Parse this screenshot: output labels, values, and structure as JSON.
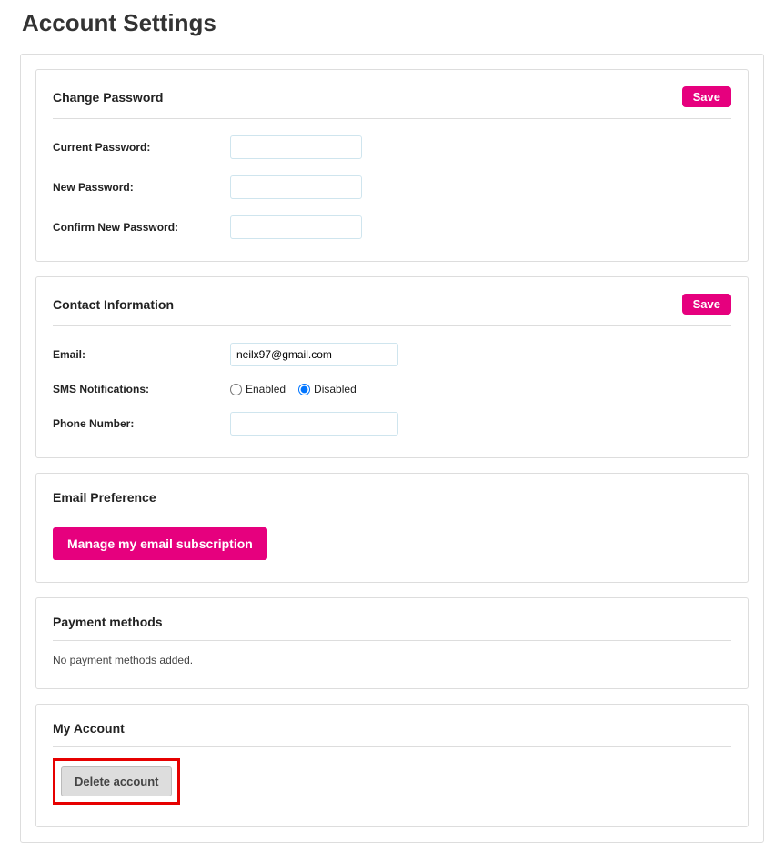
{
  "page": {
    "title": "Account Settings"
  },
  "password_panel": {
    "title": "Change Password",
    "save_label": "Save",
    "fields": {
      "current_label": "Current Password:",
      "current_value": "",
      "new_label": "New Password:",
      "new_value": "",
      "confirm_label": "Confirm New Password:",
      "confirm_value": ""
    }
  },
  "contact_panel": {
    "title": "Contact Information",
    "save_label": "Save",
    "email_label": "Email:",
    "email_value": "neilx97@gmail.com",
    "sms_label": "SMS Notifications:",
    "sms_enabled_label": "Enabled",
    "sms_disabled_label": "Disabled",
    "sms_selected": "disabled",
    "phone_label": "Phone Number:",
    "phone_value": ""
  },
  "email_pref_panel": {
    "title": "Email Preference",
    "manage_label": "Manage my email subscription"
  },
  "payment_panel": {
    "title": "Payment methods",
    "empty_text": "No payment methods added."
  },
  "account_panel": {
    "title": "My Account",
    "delete_label": "Delete account"
  }
}
